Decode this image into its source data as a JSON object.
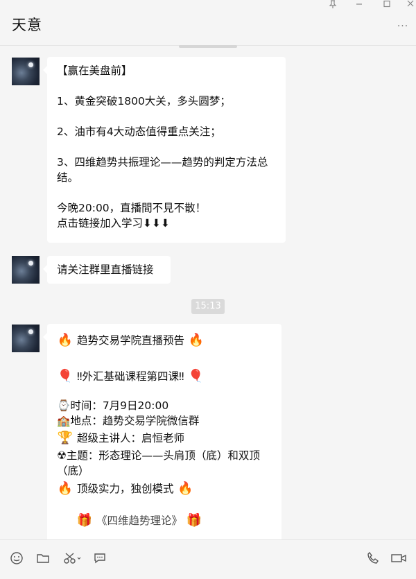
{
  "window": {
    "title": "天意",
    "pin_icon": "pin-icon",
    "minimize_icon": "minimize-icon",
    "maximize_icon": "maximize-icon",
    "close_icon": "close-icon",
    "more_icon": "more-options-icon"
  },
  "messages": [
    {
      "lines": [
        "【赢在美盘前】",
        "",
        "1、黄金突破1800大关，多头圆梦；",
        "",
        "2、油市有4大动态值得重点关注；",
        "",
        "3、四维趋势共振理论——趋势的判定方法总结。",
        "",
        "今晚20:00，直播間不見不散！",
        "点击链接加入学习⬇⬇⬇"
      ]
    },
    {
      "lines": [
        "请关注群里直播链接"
      ]
    }
  ],
  "timestamp": "15:13",
  "announcement": {
    "headline": "趋势交易学院直播预告",
    "course": "‼外汇基础课程第四课‼",
    "time": "时间：7月9日20:00",
    "location": "地点：趋势交易学院微信群",
    "speaker": "超级主讲人：启恒老师",
    "topic": "主题：形态理论——头肩顶（底）和双顶（底）",
    "tagline": "顶级实力，独创模式",
    "cut_line": "《四维趋势理论》"
  },
  "icons": {
    "fire": "🔥",
    "balloon": "🎈",
    "clock": "⌚",
    "building": "🏫",
    "trophy": "🏆",
    "topic": "☢",
    "gift": "🎁"
  },
  "input_toolbar": {
    "emoji_icon": "emoji-icon",
    "file_icon": "folder-icon",
    "screenshot_icon": "scissors-icon",
    "chat_history_icon": "chat-history-icon",
    "voice_call_icon": "phone-icon",
    "video_call_icon": "video-camera-icon"
  }
}
